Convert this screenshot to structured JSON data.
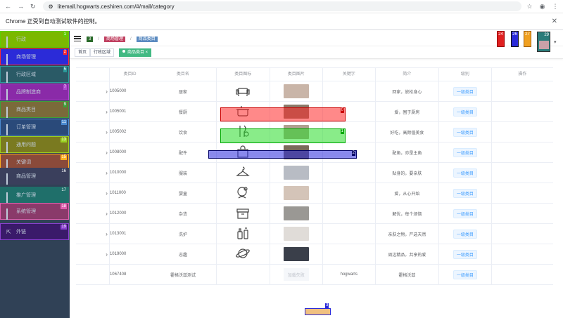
{
  "browser": {
    "url": "litemall.hogwarts.ceshiren.com/#/mall/category",
    "info_bar": "Chrome 正受到自动测试软件的控制。"
  },
  "sidebar": {
    "items": [
      {
        "label": "行政",
        "num": "1",
        "color": "#7bb800",
        "border": "#5fcf00"
      },
      {
        "label": "商场管理",
        "num": "2",
        "color": "#2b2bd8",
        "border": "#ff2a2a"
      },
      {
        "label": "行政区域",
        "num": "5",
        "color": "#2a5a66",
        "border": "#2a9a9a"
      },
      {
        "label": "品牌制造商",
        "num": "7",
        "color": "#8a2aa8",
        "border": "#b04ad0"
      },
      {
        "label": "商品类目",
        "num": "9",
        "color": "#7a6a3a",
        "border": "#3aa03a"
      },
      {
        "label": "订单管理",
        "num": "11",
        "color": "#2a4a7a",
        "border": "#4a8ad0"
      },
      {
        "label": "通用问题",
        "num": "13",
        "color": "#7a7a20",
        "border": "#9ad020"
      },
      {
        "label": "关键词",
        "num": "15",
        "color": "#8a4a3a",
        "border": "#ffb020"
      },
      {
        "label": "商品管理",
        "num": "16",
        "color": "#3a3f5c",
        "border": "#3a3f5c"
      },
      {
        "label": "推广管理",
        "num": "17",
        "color": "#1f6f6a",
        "border": "#1f6f6a"
      },
      {
        "label": "系统管理",
        "num": "18",
        "color": "#8a3a6a",
        "border": "#e060b0"
      },
      {
        "label": "外链",
        "num": "19",
        "color": "#3a1a6a",
        "border": "#8a40d0"
      }
    ]
  },
  "header": {
    "breadcrumb": [
      "首页",
      "商场管理",
      "商品类目"
    ],
    "breadcrumb_num": "3",
    "buttons": [
      {
        "num": "24",
        "color": "#e02020"
      },
      {
        "num": "26",
        "color": "#2020c0"
      },
      {
        "num": "27",
        "color": "#f0a020"
      }
    ],
    "avatar_num": "29"
  },
  "tags": [
    "首页",
    "行政区域",
    "商品类目"
  ],
  "table": {
    "headers": [
      "类目ID",
      "类目名",
      "类目图标",
      "类目图片",
      "关键字",
      "简介",
      "级别",
      "操作"
    ],
    "rows": [
      {
        "id": "1005000",
        "name": "居家",
        "icon": "sofa-icon",
        "desc": "回家，放松身心",
        "level": "一级类目",
        "keyword": ""
      },
      {
        "id": "1005001",
        "name": "餐厨",
        "icon": "pot-icon",
        "desc": "爱，囿于厨房",
        "level": "一级类目",
        "keyword": ""
      },
      {
        "id": "1005002",
        "name": "饮食",
        "icon": "food-icon",
        "desc": "好吃，高颜值美食",
        "level": "一级类目",
        "keyword": ""
      },
      {
        "id": "1008000",
        "name": "配件",
        "icon": "bag-icon",
        "desc": "配角，亦是主角",
        "level": "一级类目",
        "keyword": ""
      },
      {
        "id": "1010000",
        "name": "服装",
        "icon": "hanger-icon",
        "desc": "贴身的，要亲肤",
        "level": "一级类目",
        "keyword": ""
      },
      {
        "id": "1011000",
        "name": "婴童",
        "icon": "baby-icon",
        "desc": "爱，从心开始",
        "level": "一级类目",
        "keyword": ""
      },
      {
        "id": "1012000",
        "name": "杂货",
        "icon": "box-icon",
        "desc": "解忧，每个烦恼",
        "level": "一级类目",
        "keyword": ""
      },
      {
        "id": "1013001",
        "name": "洗护",
        "icon": "bottle-icon",
        "desc": "亲肤之物，严选天然",
        "level": "一级类目",
        "keyword": ""
      },
      {
        "id": "1019000",
        "name": "志趣",
        "icon": "planet-icon",
        "desc": "周边精品，共享热爱",
        "level": "一级类目",
        "keyword": ""
      },
      {
        "id": "1067408",
        "name": "霍格沃兹测试",
        "icon": "",
        "desc": "霍格沃兹",
        "level": "一级类目",
        "keyword": "hogwarts",
        "nopic": "加载失败"
      }
    ]
  },
  "overlays": [
    {
      "num": "0",
      "color": "#ff2a2a"
    },
    {
      "num": "1",
      "color": "#2ad82a"
    },
    {
      "num": "2",
      "color": "#2a2ad8"
    },
    {
      "num": "3",
      "color": "#2a2ad8"
    }
  ]
}
